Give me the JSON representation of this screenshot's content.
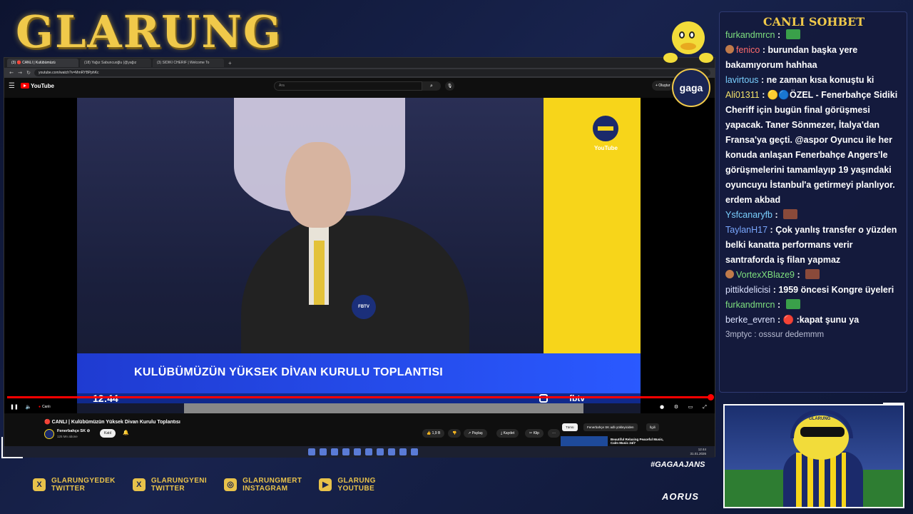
{
  "overlay": {
    "brand": "GLARUNG",
    "hashtag": "#GAGAAJANS",
    "sponsor": "AORUS",
    "gaga_logo": "gaga",
    "socials": [
      {
        "icon": "x-icon",
        "glyph": "X",
        "line1": "GLARUNGYEDEK",
        "line2": "TWITTER"
      },
      {
        "icon": "x-icon",
        "glyph": "X",
        "line1": "GLARUNGYENI",
        "line2": "TWITTER"
      },
      {
        "icon": "instagram-icon",
        "glyph": "◎",
        "line1": "GLARUNGMERT",
        "line2": "INSTAGRAM"
      },
      {
        "icon": "youtube-icon",
        "glyph": "▶",
        "line1": "GLARUNG",
        "line2": "YOUTUBE"
      }
    ],
    "cam_cap_label": "GLARUNG"
  },
  "browser": {
    "tabs": [
      {
        "label": "(3) 🔴 CANLI | Kulübümüzü",
        "active": true
      },
      {
        "label": "(18) Yağız Sabuncuoğlu (@yağız",
        "active": false
      },
      {
        "label": "(3) SIDIKI CHERIF | Welcome To",
        "active": false
      }
    ],
    "new_tab": "+",
    "url": "youtube.com/watch?v=MmRYBPphKc"
  },
  "youtube": {
    "logo_text": "YouTube",
    "search_placeholder": "Ara",
    "create_label": "+ Oluştur",
    "video": {
      "lower_third": "KULÜBÜMÜZÜN YÜKSEK DİVAN KURULU TOPLANTISI",
      "clock": "12:44",
      "fbtv": "fbtv",
      "mic_label": "FBTV",
      "corner_label": "YouTube"
    },
    "controls": {
      "live_label": "Canlı",
      "progress": 1.0
    },
    "title": "🔴 CANLI | Kulübümüzün Yüksek Divan Kurulu Toplantısı",
    "channel": {
      "name": "Fenerbahçe SK ⊘",
      "subscribers": "125 Mn abone",
      "join_label": "Katıl"
    },
    "actions": {
      "like_count": "👍 1,9 B",
      "dislike": "👎",
      "share": "↗ Paylaş",
      "save": "⤓ Kaydet",
      "clip": "✂ Klip",
      "more": "⋯"
    },
    "chips": [
      {
        "label": "Tümü",
        "active": true
      },
      {
        "label": "Fenerbahçe SK adlı yükleyiciden",
        "active": false
      },
      {
        "label": "İlgili",
        "active": false
      }
    ],
    "recommendation_title": "Beautiful Relaxing Peaceful Music, Calm Music 24/7"
  },
  "taskbar": {
    "time": "12:44",
    "date": "31.01.2026"
  },
  "chat": {
    "title": "CANLI SOHBET",
    "messages": [
      {
        "user": "furkandmrcn",
        "user_color": "#7ee07e",
        "text": "",
        "sticker": "#3aa04a",
        "first": true
      },
      {
        "user": "fenico",
        "user_color": "#ff6b6b",
        "text": "burundan başka yere bakamıyorum hahhaa",
        "badge": "#c07a4a"
      },
      {
        "user": "lavirtous",
        "user_color": "#7ad0ff",
        "text": "ne zaman kısa konuştu ki"
      },
      {
        "user": "Ali01311",
        "user_color": "#f3e26a",
        "text": "🟡🔵ÖZEL - Fenerbahçe Sidiki Cheriff için bugün final görüşmesi yapacak. Taner Sönmezer, İtalya'dan Fransa'ya geçti. @aspor Oyuncu ile her konuda anlaşan Fenerbahçe Angers'le görüşmelerini tamamlayıp 19 yaşındaki oyuncuyu İstanbul'a getirmeyi planlıyor. erdem akbad"
      },
      {
        "user": "Ysfcanaryfb",
        "user_color": "#7ad0ff",
        "text": "",
        "sticker": "#8a4a3a"
      },
      {
        "user": "TaylanH17",
        "user_color": "#7aa8ff",
        "text": "Çok yanlış transfer o yüzden belki kanatta performans verir santraforda iş filan yapmaz"
      },
      {
        "user": "VortexXBlaze9",
        "user_color": "#7ee07e",
        "text": "",
        "sticker": "#8a4a3a",
        "badge": "#c07a4a"
      },
      {
        "user": "pittikdelicisi",
        "user_color": "#dde3ff",
        "text": "1959 öncesi Kongre üyeleri"
      },
      {
        "user": "furkandmrcn",
        "user_color": "#7ee07e",
        "text": "",
        "sticker": "#3aa04a"
      },
      {
        "user": "berke_evren",
        "user_color": "#dde3ff",
        "text": "🔴 :kapat şunu ya"
      },
      {
        "user": "3mptyc",
        "user_color": "#b9bdd3",
        "text": "osssur dedemmm",
        "faded": true
      }
    ]
  }
}
